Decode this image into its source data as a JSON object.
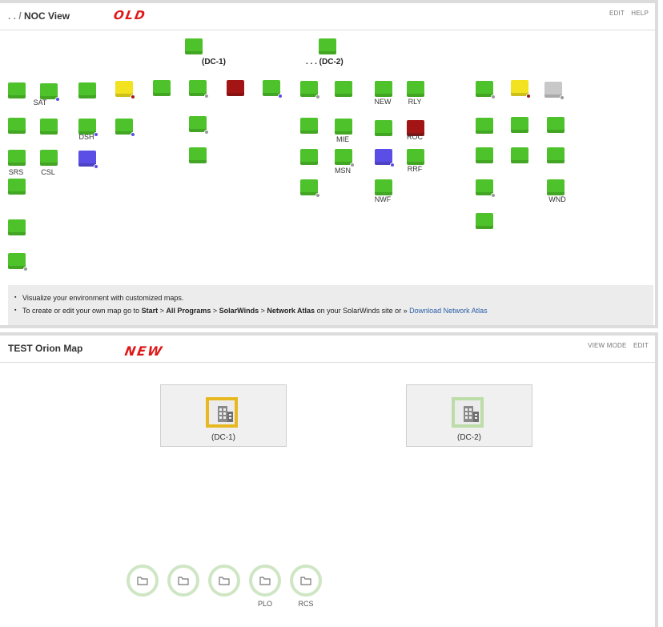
{
  "top": {
    "title": "NOC View",
    "actions": [
      "EDIT",
      "HELP"
    ],
    "annotation": "OLD",
    "dc_labels": [
      "(DC-1)",
      "(DC-2)"
    ],
    "node_labels": [
      "SAT",
      "NEW",
      "RLY",
      "DSH",
      "ROC",
      "MIE",
      "SRS",
      "CSL",
      "MSN",
      "RRF",
      "NWF",
      "WND"
    ],
    "colors": {
      "green": "#4ec22a",
      "yellow": "#f3e21f",
      "red": "#a31515",
      "blue": "#5a4ee6",
      "gray": "#c8c8c8"
    },
    "info": {
      "line1": "Visualize your environment with customized maps.",
      "line2_pre": "To create or edit your own map go to ",
      "path": [
        "Start",
        "All Programs",
        "SolarWinds",
        "Network Atlas"
      ],
      "line2_mid": " on your SolarWinds site or » ",
      "link": "Download Network Atlas"
    }
  },
  "bottom": {
    "title": "TEST Orion Map",
    "actions": [
      "VIEW MODE",
      "EDIT"
    ],
    "annotation": "NEW",
    "dc1": "(DC-1)",
    "dc2": "(DC-2)",
    "group_labels": [
      "",
      "",
      "",
      "PLO",
      "RCS"
    ],
    "colors": {
      "warning": "#e8b820",
      "ok": "#bcdca8",
      "folder_ring": "#cfe6c4"
    }
  }
}
